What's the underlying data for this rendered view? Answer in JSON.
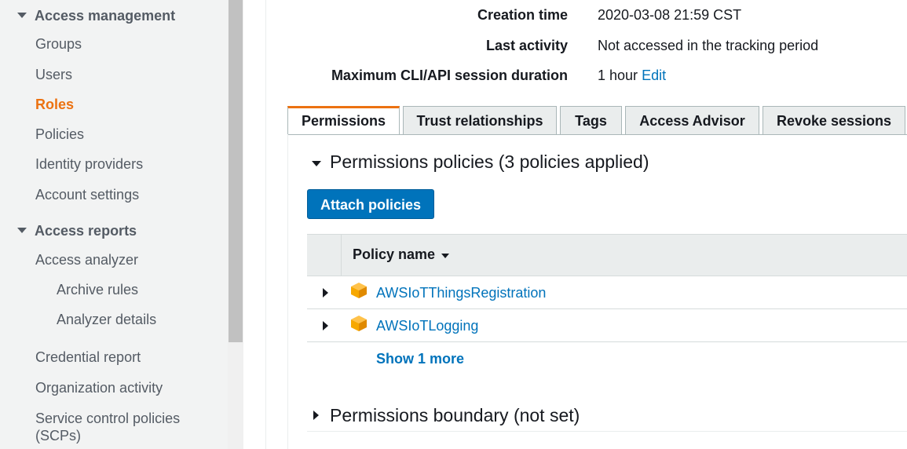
{
  "sidebar": {
    "sections": [
      {
        "label": "Access management"
      },
      {
        "label": "Access reports"
      }
    ],
    "items": [
      {
        "label": "Groups"
      },
      {
        "label": "Users"
      },
      {
        "label": "Roles"
      },
      {
        "label": "Policies"
      },
      {
        "label": "Identity providers"
      },
      {
        "label": "Account settings"
      },
      {
        "label": "Access analyzer"
      },
      {
        "label": "Archive rules"
      },
      {
        "label": "Analyzer details"
      },
      {
        "label": "Credential report"
      },
      {
        "label": "Organization activity"
      },
      {
        "label": "Service control policies"
      },
      {
        "label": "(SCPs)"
      }
    ],
    "active_item": "Roles"
  },
  "summary": {
    "creation_time_label": "Creation time",
    "creation_time_value": "2020-03-08 21:59 CST",
    "last_activity_label": "Last activity",
    "last_activity_value": "Not accessed in the tracking period",
    "session_label": "Maximum CLI/API session duration",
    "session_value": "1 hour",
    "session_edit": "Edit"
  },
  "tabs": [
    {
      "label": "Permissions"
    },
    {
      "label": "Trust relationships"
    },
    {
      "label": "Tags"
    },
    {
      "label": "Access Advisor"
    },
    {
      "label": "Revoke sessions"
    }
  ],
  "permissions": {
    "title": "Permissions policies (3 policies applied)",
    "attach_label": "Attach policies",
    "column_policy_name": "Policy name",
    "policies": [
      {
        "name": "AWSIoTThingsRegistration",
        "icon": "aws-managed-cube-icon"
      },
      {
        "name": "AWSIoTLogging",
        "icon": "aws-managed-cube-icon"
      }
    ],
    "show_more": "Show 1 more"
  },
  "boundary": {
    "title": "Permissions boundary (not set)"
  },
  "colors": {
    "accent": "#ec7211",
    "link": "#0073bb",
    "button": "#0073bb",
    "cube": "#f7a800"
  }
}
